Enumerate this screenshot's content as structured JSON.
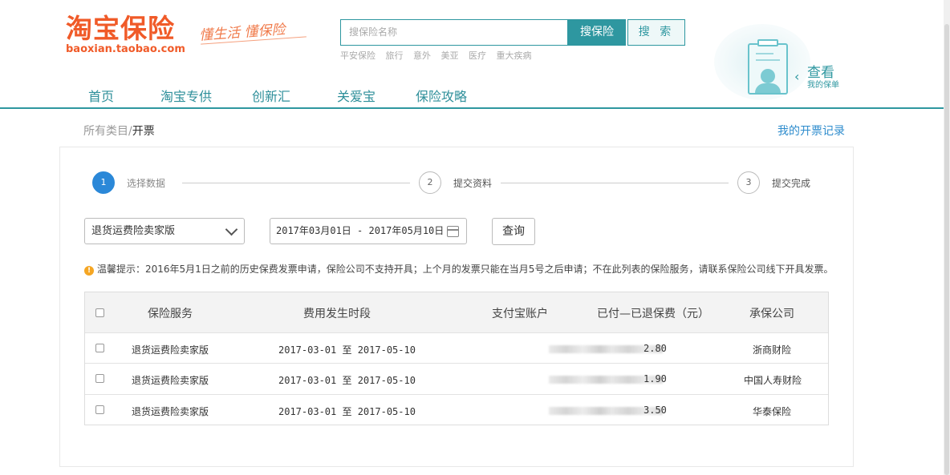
{
  "brand": {
    "logo_text": "淘宝保险",
    "logo_url": "baoxian.taobao.com",
    "slogan": "懂生活 懂保险",
    "color": "#f05a28"
  },
  "search": {
    "placeholder": "搜保险名称",
    "primary_button": "搜保险",
    "secondary_button": "搜 索",
    "hot_words": [
      "平安保险",
      "旅行",
      "意外",
      "美亚",
      "医疗",
      "重大疾病"
    ]
  },
  "my_policy": {
    "title": "查看",
    "subtitle": "我的保单"
  },
  "nav": {
    "items": [
      "首页",
      "淘宝专供",
      "创新汇",
      "关爱宝",
      "保险攻略"
    ],
    "accent": "#2e97a0"
  },
  "breadcrumb": {
    "parent": "所有类目",
    "separator": "/",
    "current": "开票"
  },
  "records_link": "我的开票记录",
  "steps": [
    {
      "number": "1",
      "label": "选择数据",
      "active": true
    },
    {
      "number": "2",
      "label": "提交资料",
      "active": false
    },
    {
      "number": "3",
      "label": "提交完成",
      "active": false
    }
  ],
  "filters": {
    "service_selected": "退货运费险卖家版",
    "date_range": "2017年03月01日 - 2017年05月10日",
    "query_button": "查询"
  },
  "tip": {
    "icon": "!",
    "text": "温馨提示：2016年5月1日之前的历史保费发票申请，保险公司不支持开具；上个月的发票只能在当月5号之后申请；不在此列表的保险服务，请联系保险公司线下开具发票。"
  },
  "table": {
    "headers": [
      "保险服务",
      "费用发生时段",
      "支付宝账户",
      "已付—已退保费（元）",
      "承保公司"
    ],
    "rows": [
      {
        "service": "退货运费险卖家版",
        "period": "2017-03-01 至 2017-05-10",
        "amount": "2.80",
        "company": "浙商财险"
      },
      {
        "service": "退货运费险卖家版",
        "period": "2017-03-01 至 2017-05-10",
        "amount": "1.90",
        "company": "中国人寿财险"
      },
      {
        "service": "退货运费险卖家版",
        "period": "2017-03-01 至 2017-05-10",
        "amount": "3.50",
        "company": "华泰保险"
      }
    ]
  }
}
